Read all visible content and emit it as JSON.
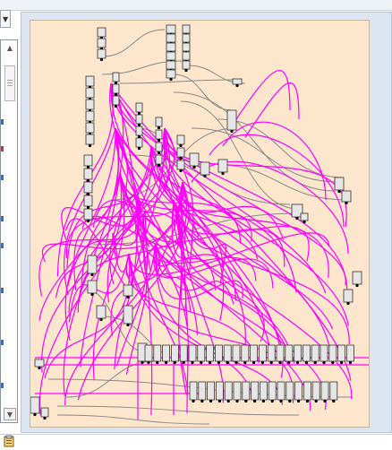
{
  "window": {
    "dropdown_arrow": "▼",
    "scroll_up_arrow": "▲",
    "scroll_down_arrow": "▼"
  },
  "icons": {
    "dropdown": "chevron-down-icon",
    "scroll_up": "chevron-up-icon",
    "scroll_down": "chevron-down-icon",
    "clipboard": "clipboard-icon"
  },
  "colors": {
    "canvas_background": "#fde6cc",
    "frame_background": "#dbe6f2",
    "wire_primary": "#ff00ff",
    "wire_secondary": "#888888",
    "node_fill": "#e6e6e6",
    "node_border": "#333333",
    "port": "#000000"
  }
}
